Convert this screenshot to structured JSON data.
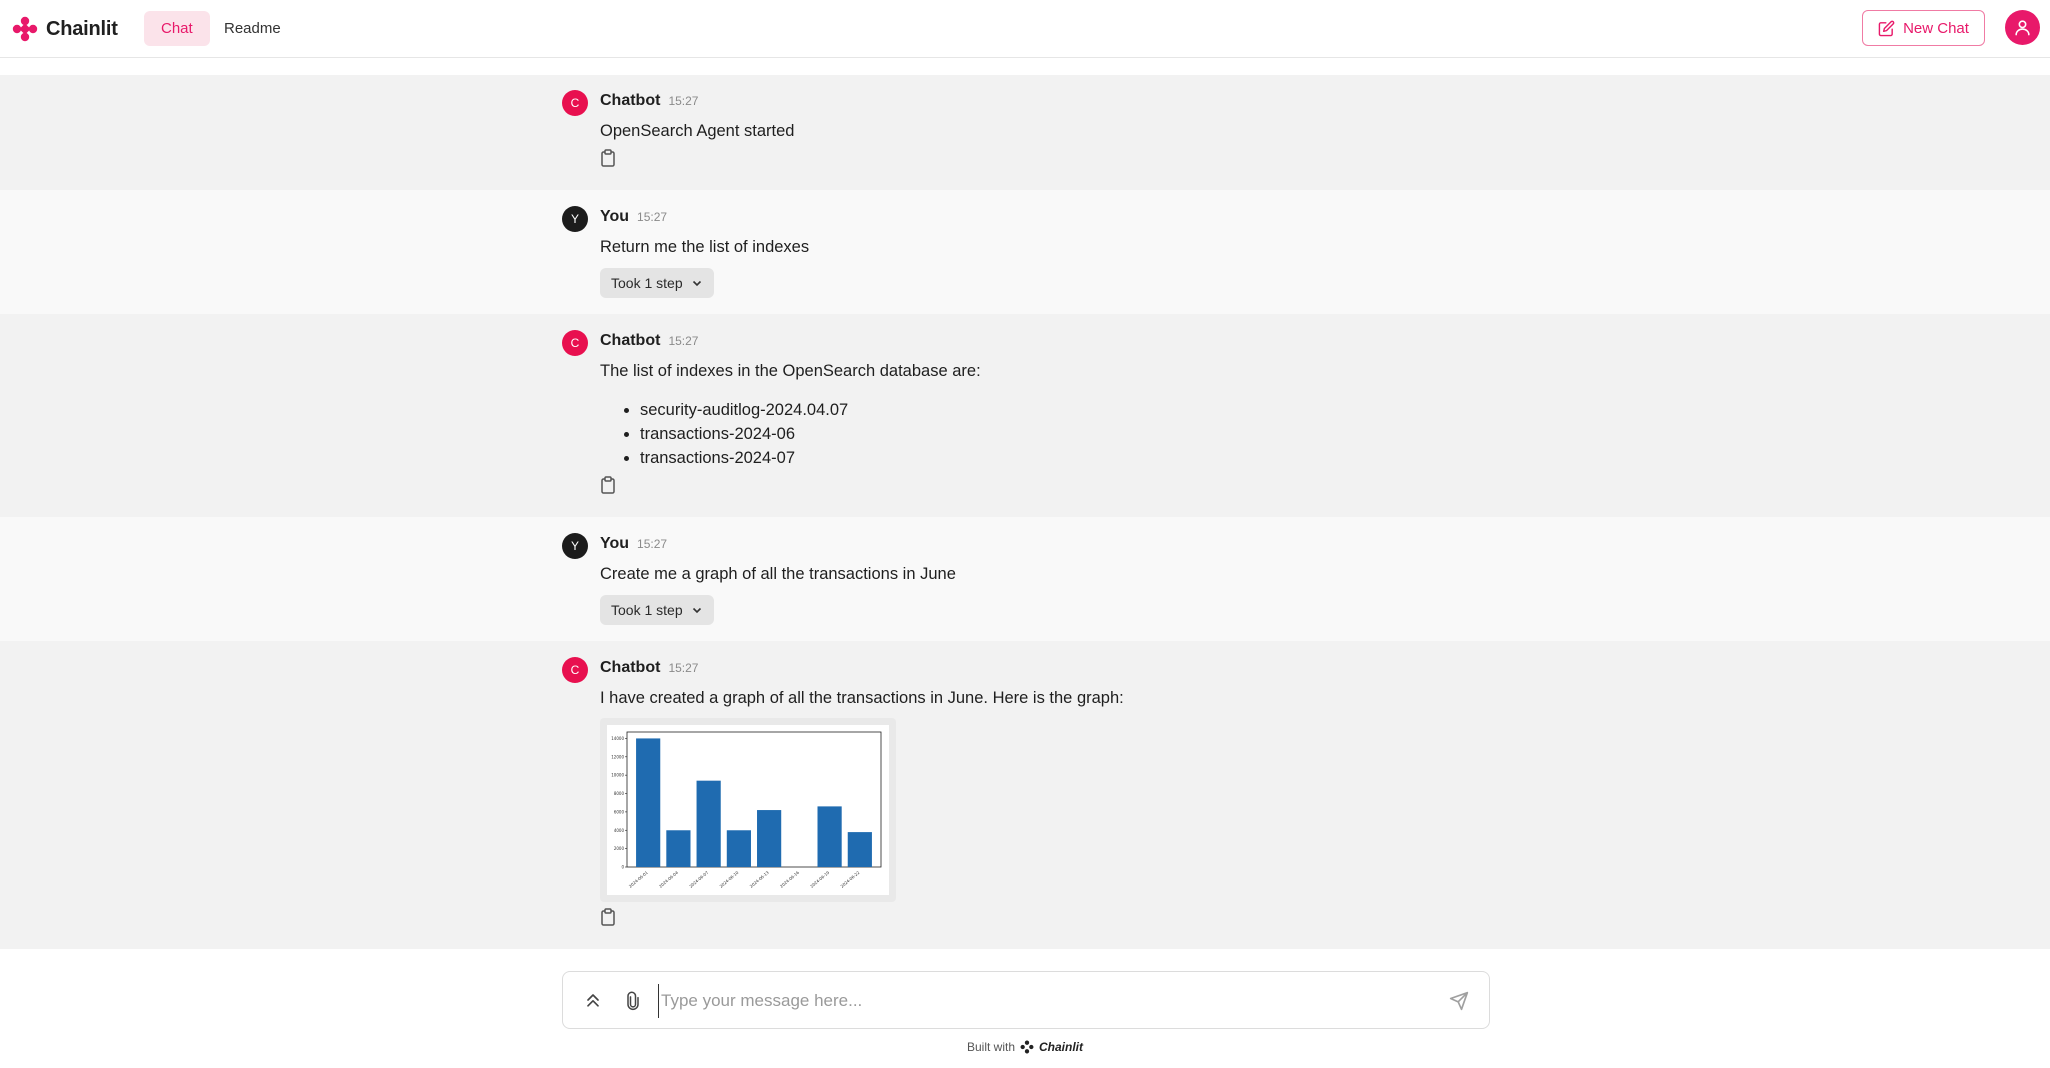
{
  "app": {
    "name": "Chainlit",
    "accent": "#e8196a"
  },
  "header": {
    "tabs": [
      {
        "label": "Chat",
        "active": true
      },
      {
        "label": "Readme",
        "active": false
      }
    ],
    "new_chat_label": "New Chat",
    "icons": {
      "new_chat": "edit-icon",
      "user": "user-icon"
    }
  },
  "messages": [
    {
      "author": "Chatbot",
      "avatar": "C",
      "time": "15:27",
      "text": "OpenSearch Agent started"
    },
    {
      "author": "You",
      "avatar": "Y",
      "time": "15:27",
      "text": "Return me the list of indexes",
      "step_label": "Took 1 step"
    },
    {
      "author": "Chatbot",
      "avatar": "C",
      "time": "15:27",
      "text": "The list of indexes in the OpenSearch database are:",
      "list": [
        "security-auditlog-2024.04.07",
        "transactions-2024-06",
        "transactions-2024-07"
      ]
    },
    {
      "author": "You",
      "avatar": "Y",
      "time": "15:27",
      "text": "Create me a graph of all the transactions in June",
      "step_label": "Took 1 step"
    },
    {
      "author": "Chatbot",
      "avatar": "C",
      "time": "15:27",
      "text": "I have created a graph of all the transactions in June. Here is the graph:"
    }
  ],
  "chart_data": {
    "type": "bar",
    "title": "",
    "xlabel": "",
    "ylabel": "",
    "categories": [
      "2024-06-01",
      "2024-06-04",
      "2024-06-07",
      "2024-06-10",
      "2024-06-13",
      "2024-06-16",
      "2024-06-19",
      "2024-06-22"
    ],
    "values": [
      14000,
      4000,
      9400,
      4000,
      6200,
      0,
      6600,
      3800
    ],
    "yticks": [
      0,
      2000,
      4000,
      6000,
      8000,
      10000,
      12000,
      14000
    ],
    "ylim": [
      0,
      14700
    ],
    "bar_color": "#1f6bb0",
    "grid": false
  },
  "composer": {
    "placeholder": "Type your message here...",
    "value": ""
  },
  "footer": {
    "built_with": "Built with",
    "brand": "Chainlit"
  }
}
